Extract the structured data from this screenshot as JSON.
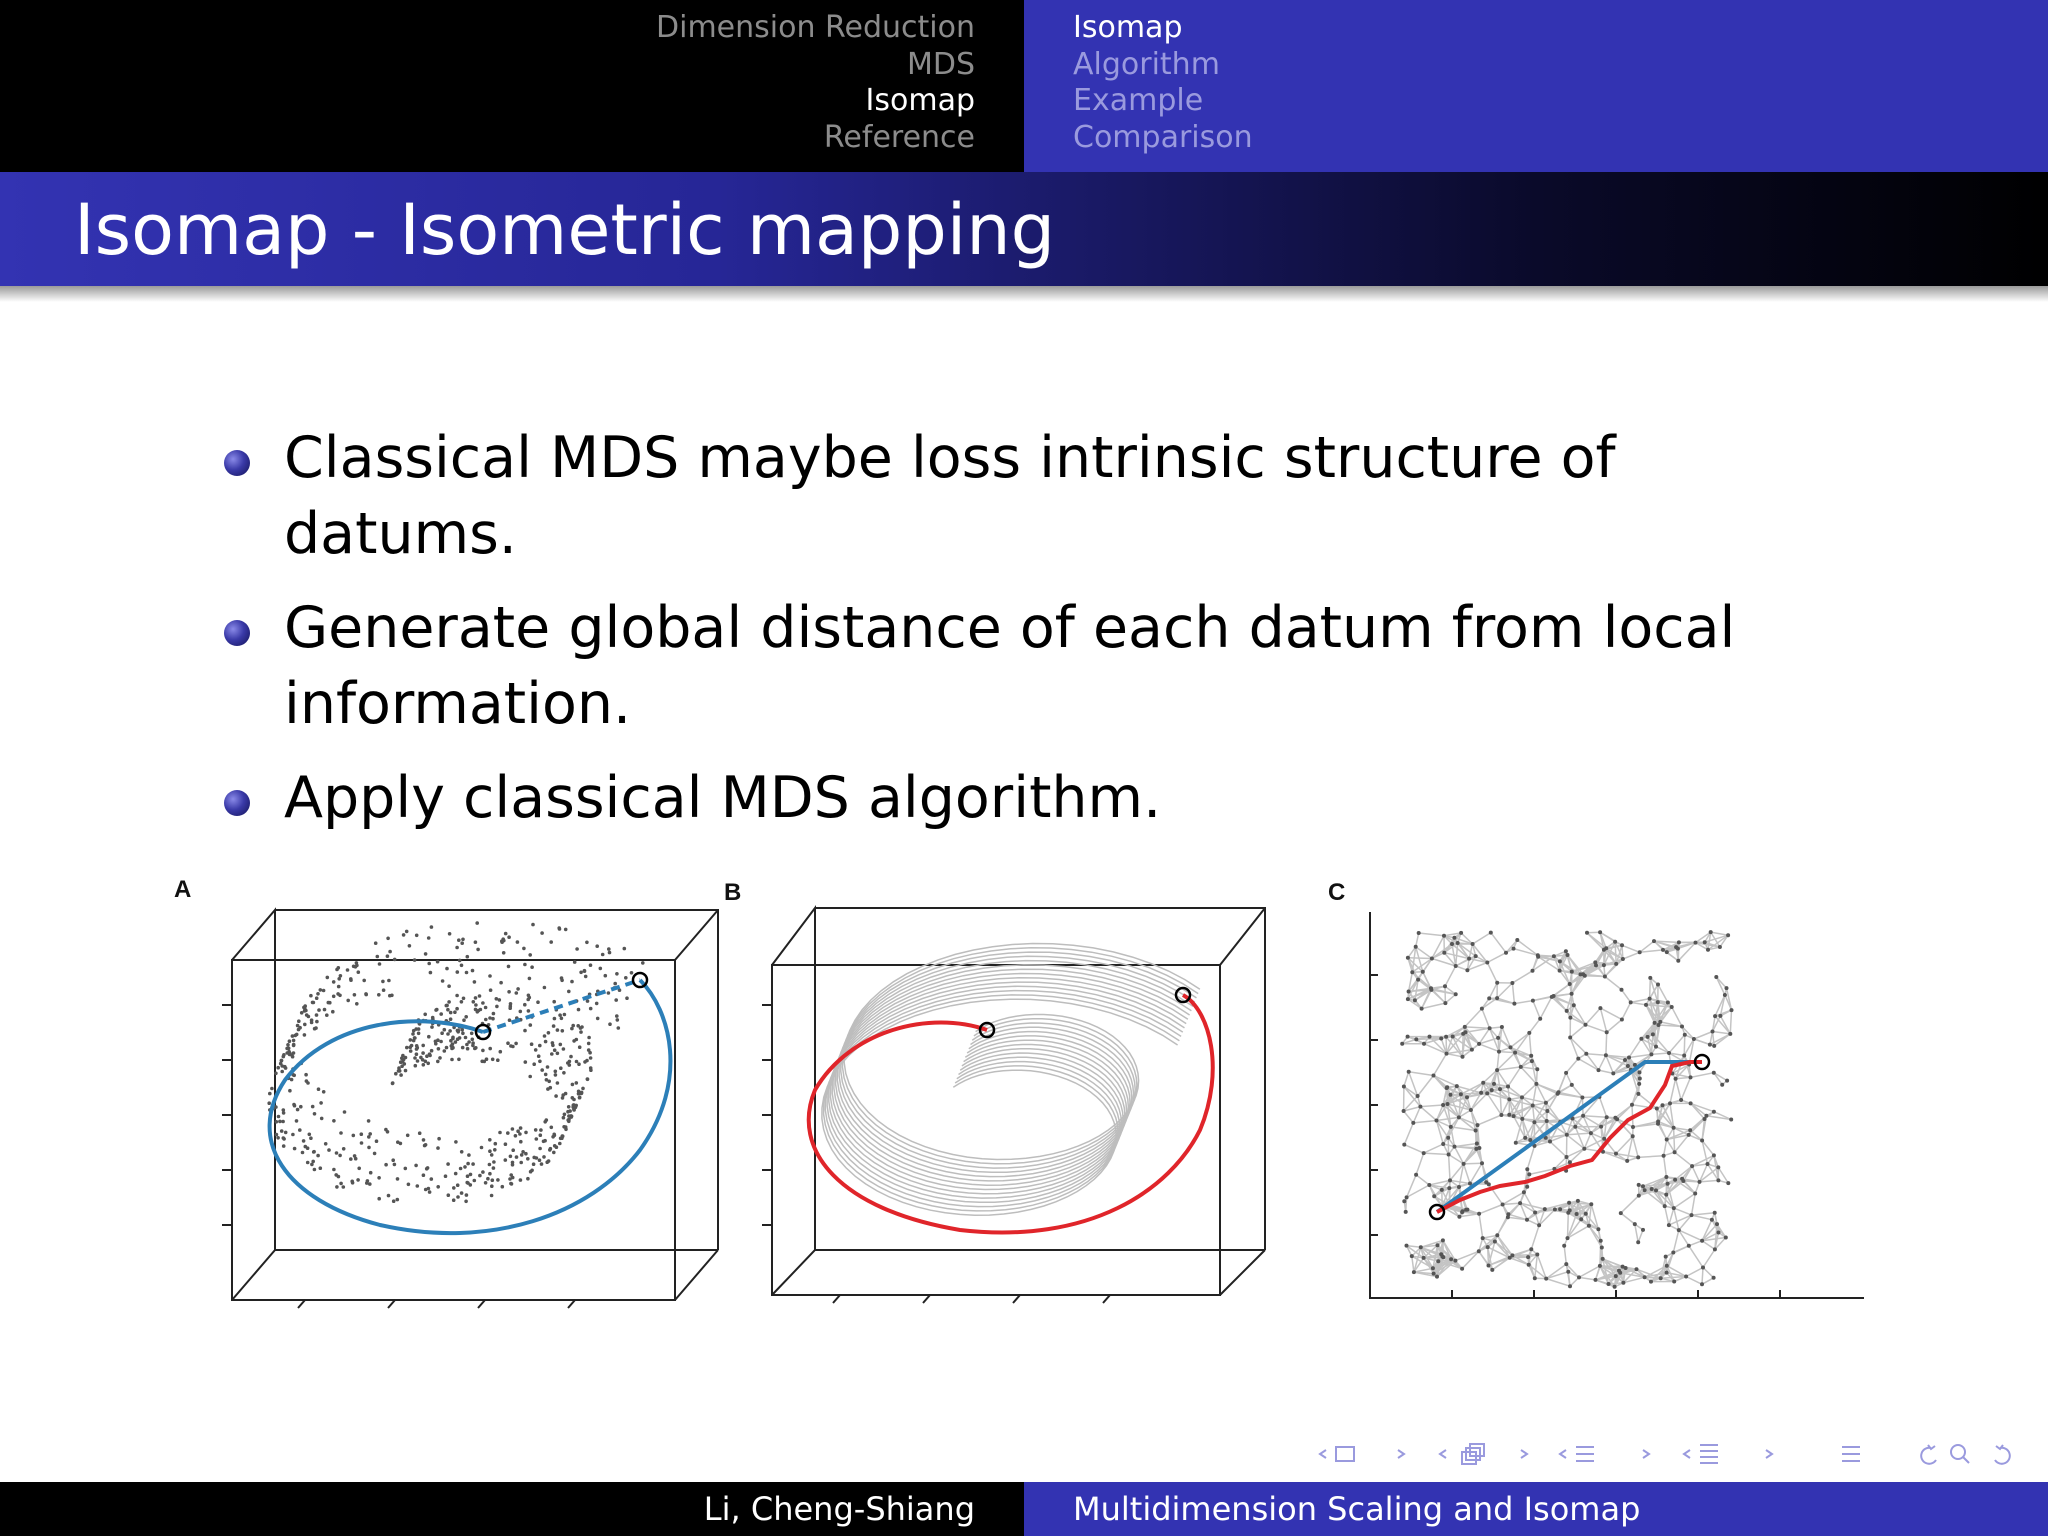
{
  "header": {
    "sections": [
      {
        "label": "Dimension Reduction",
        "active": false
      },
      {
        "label": "MDS",
        "active": false
      },
      {
        "label": "Isomap",
        "active": true
      },
      {
        "label": "Reference",
        "active": false
      }
    ],
    "subsections": [
      {
        "label": "Isomap",
        "active": true
      },
      {
        "label": "Algorithm",
        "active": false
      },
      {
        "label": "Example",
        "active": false
      },
      {
        "label": "Comparison",
        "active": false
      }
    ]
  },
  "slide": {
    "title": "Isomap - Isometric mapping",
    "bullets": [
      "Classical MDS maybe loss intrinsic structure of datums.",
      "Generate global distance of each datum from local information.",
      "Apply classical MDS algorithm."
    ],
    "figure": {
      "panels": [
        "A",
        "B",
        "C"
      ],
      "colors": {
        "geodesic_blue": "#2c7fb8",
        "graph_path_red": "#e0252a",
        "graph_gray": "#c4c4c4",
        "points": "#555555"
      }
    }
  },
  "footer": {
    "author": "Li, Cheng-Shiang",
    "title": "Multidimension Scaling and Isomap"
  },
  "colors": {
    "theme_blue": "#3333b2",
    "header_black": "#000000"
  },
  "nav_icons": [
    "arrow-left-icon",
    "frame-icon",
    "arrow-right-icon",
    "subsection-icon",
    "section-icon",
    "appendix-icon",
    "search-icon",
    "undo-icon"
  ]
}
